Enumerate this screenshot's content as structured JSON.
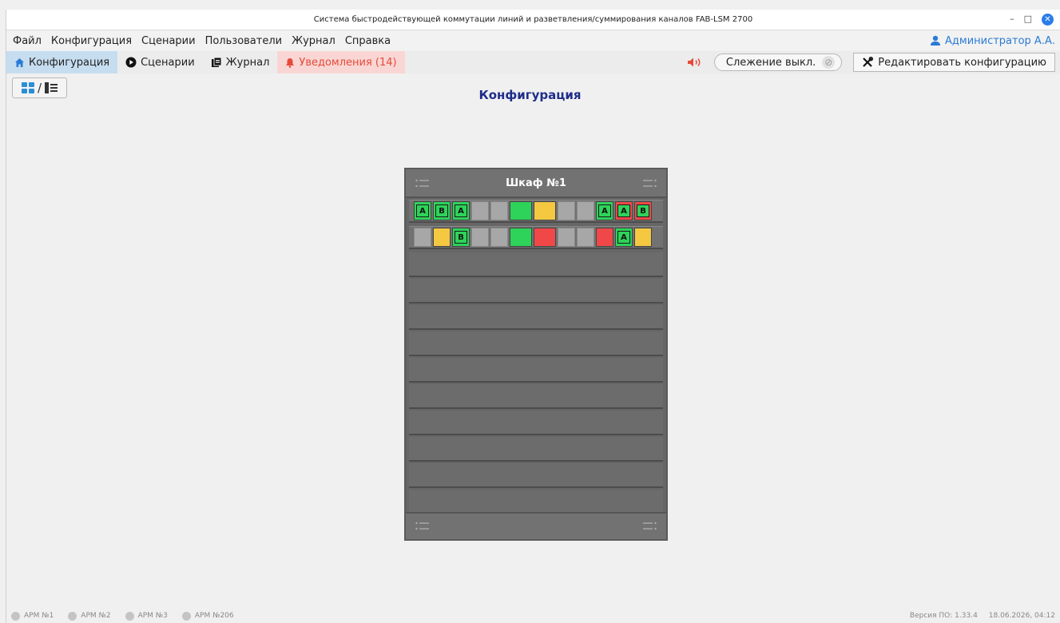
{
  "window": {
    "title": "Система быстродействующей коммутации линий и разветвления/суммирования каналов FAB-LSM 2700",
    "minimize": "–",
    "maximize": "□",
    "close": "✕"
  },
  "menu": {
    "items": [
      "Файл",
      "Конфигурация",
      "Сценарии",
      "Пользователи",
      "Журнал",
      "Справка"
    ],
    "user": "Администратор А.А."
  },
  "toolbar": {
    "tabs": [
      {
        "label": "Конфигурация",
        "icon": "home-icon"
      },
      {
        "label": "Сценарии",
        "icon": "play-icon"
      },
      {
        "label": "Журнал",
        "icon": "journal-icon"
      },
      {
        "label": "Уведомления (14)",
        "icon": "bell-icon"
      }
    ],
    "tracking_label": "Слежение выкл.",
    "edit_label": "Редактировать конфигурацию"
  },
  "view_toggle": {
    "separator": "/"
  },
  "page": {
    "title": "Конфигурация"
  },
  "cabinet": {
    "title": "Шкаф №1",
    "empty_units": 10,
    "rows": [
      [
        {
          "status": "green",
          "label": "A"
        },
        {
          "status": "green",
          "label": "B"
        },
        {
          "status": "green",
          "label": "A"
        },
        {
          "status": "gray",
          "label": ""
        },
        {
          "status": "gray",
          "label": ""
        },
        {
          "status": "green",
          "label": "",
          "wide": true
        },
        {
          "status": "yellow",
          "label": "",
          "wide": true
        },
        {
          "status": "gray",
          "label": ""
        },
        {
          "status": "gray",
          "label": ""
        },
        {
          "status": "green",
          "label": "A"
        },
        {
          "status": "red",
          "label": "A"
        },
        {
          "status": "red",
          "label": "B"
        }
      ],
      [
        {
          "status": "gray",
          "label": ""
        },
        {
          "status": "yellow",
          "label": ""
        },
        {
          "status": "green",
          "label": "B"
        },
        {
          "status": "gray",
          "label": ""
        },
        {
          "status": "gray",
          "label": ""
        },
        {
          "status": "green",
          "label": "",
          "wide": true
        },
        {
          "status": "red",
          "label": "",
          "wide": true
        },
        {
          "status": "gray",
          "label": ""
        },
        {
          "status": "gray",
          "label": ""
        },
        {
          "status": "red",
          "label": ""
        },
        {
          "status": "green",
          "label": "A"
        },
        {
          "status": "yellow",
          "label": ""
        }
      ]
    ]
  },
  "status": {
    "workstations": [
      "АРМ №1",
      "АРМ №2",
      "АРМ №3",
      "АРМ №206"
    ],
    "version": "Версия ПО: 1.33.4",
    "datetime": "18.06.2026, 04:12"
  },
  "colors": {
    "accent": "#2a7bd6",
    "title": "#1f2d8a",
    "alert": "#e64a3b",
    "ok": "#2ed35a",
    "warn": "#f5c842",
    "error": "#f04848",
    "inactive": "#a7a7a7"
  }
}
